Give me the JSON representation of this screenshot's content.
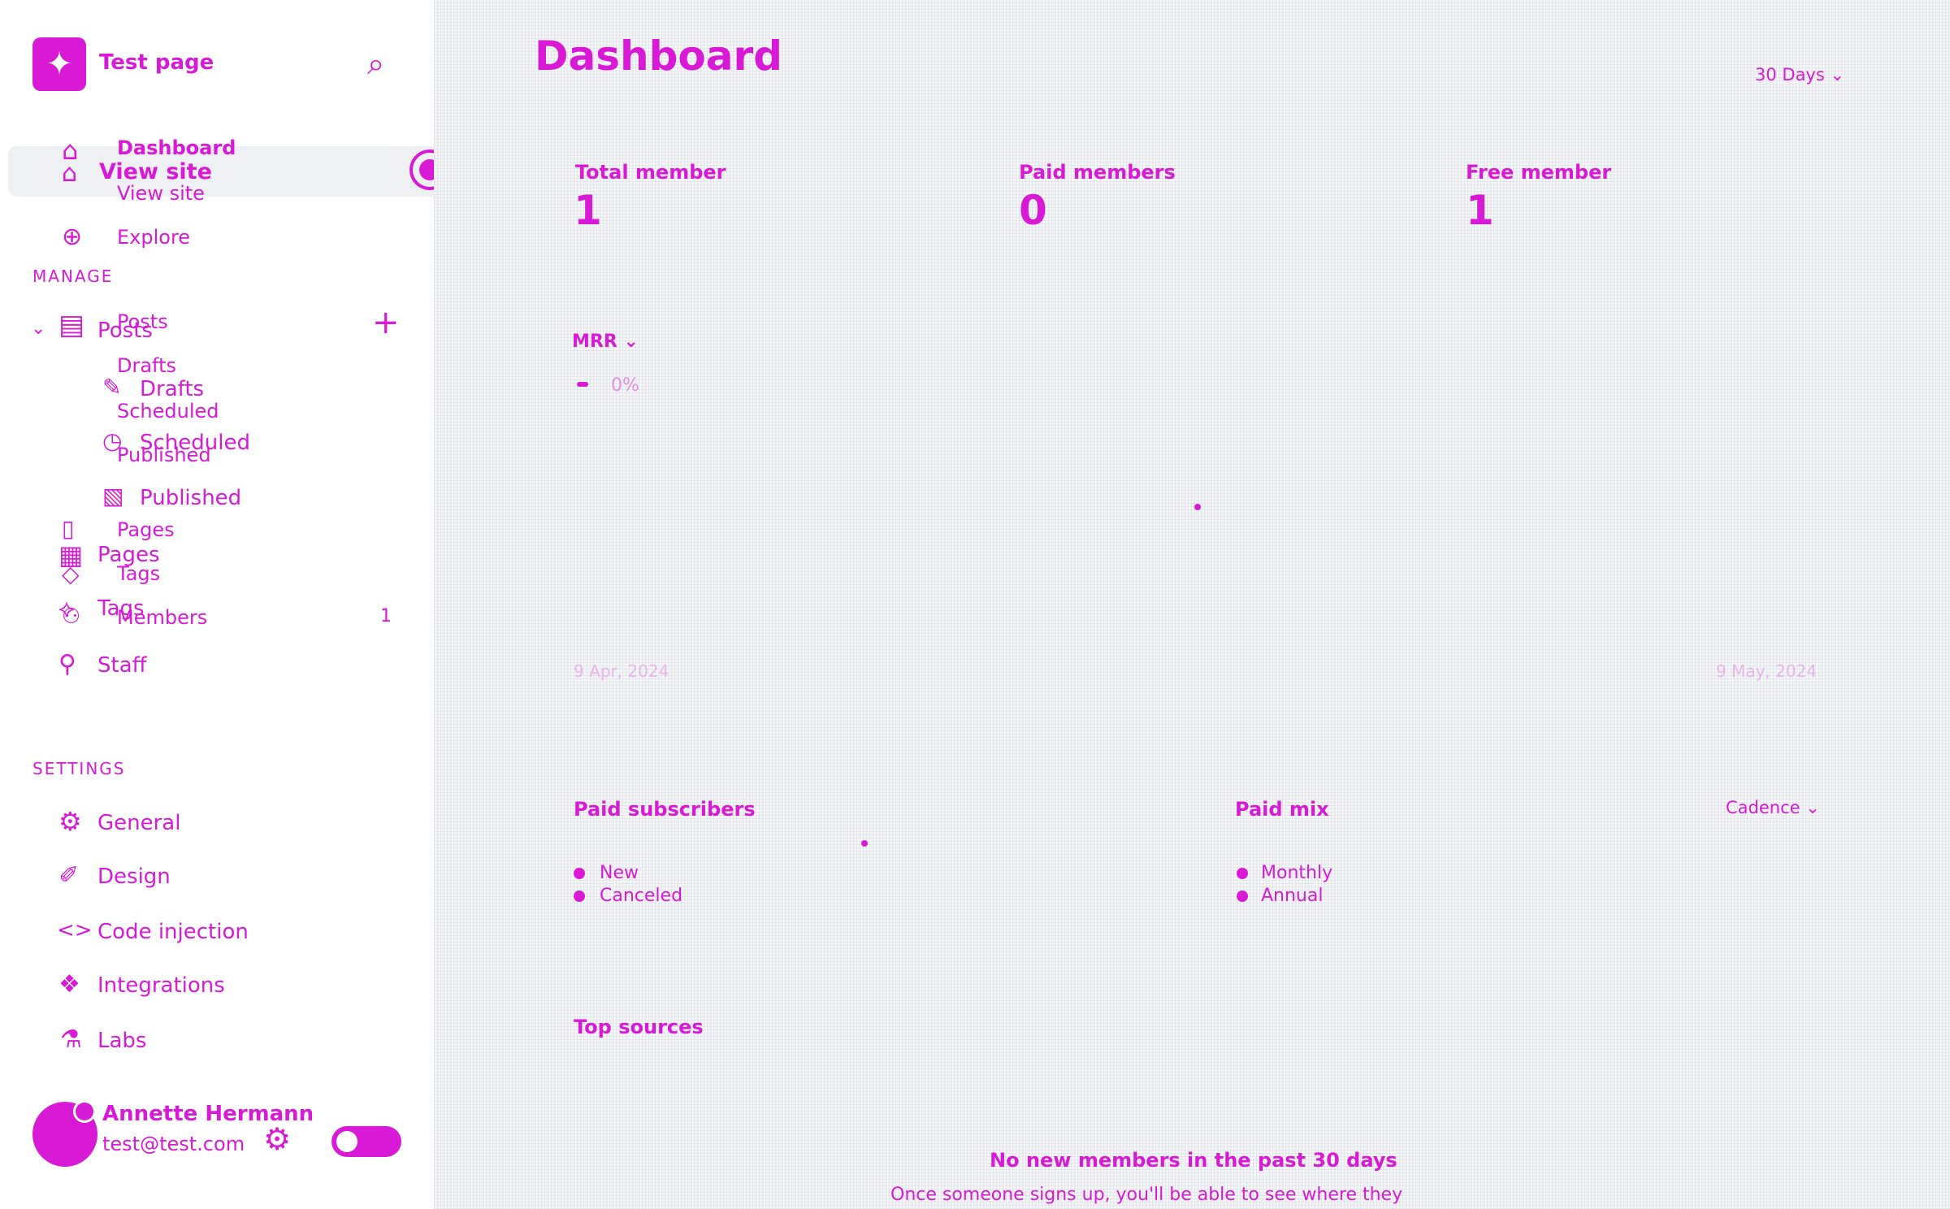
{
  "site": {
    "title": "Test page"
  },
  "sidebar": {
    "nav": {
      "dashboard": "Dashboard",
      "view_site": "View site",
      "explore": "Explore"
    },
    "manage_heading": "MANAGE",
    "manage": {
      "posts": "Posts",
      "drafts": "Drafts",
      "scheduled": "Scheduled",
      "published": "Published",
      "pages": "Pages",
      "tags": "Tags",
      "members": "Members",
      "members_count": "1",
      "staff": "Staff"
    },
    "settings_heading": "SETTINGS",
    "settings": {
      "general": "General",
      "design": "Design",
      "code_injection": "Code injection",
      "integrations": "Integrations",
      "labs": "Labs"
    },
    "user": {
      "name": "Annette Hermann",
      "email": "test@test.com"
    }
  },
  "main": {
    "title": "Dashboard",
    "range": "30 Days",
    "stats": [
      {
        "label": "Total member",
        "value": "1"
      },
      {
        "label": "Paid members",
        "value": "0"
      },
      {
        "label": "Free member",
        "value": "1"
      }
    ],
    "mrr": {
      "label": "MRR",
      "change": "0%"
    },
    "chart_dates": {
      "start": "9 Apr, 2024",
      "end": "9 May, 2024"
    },
    "paid_subscribers": {
      "title": "Paid subscribers",
      "legend": [
        "New",
        "Canceled"
      ]
    },
    "paid_mix": {
      "title": "Paid mix",
      "selector": "Cadence",
      "legend": [
        "Monthly",
        "Annual"
      ]
    },
    "top_sources": {
      "title": "Top sources",
      "empty_title": "No new members in the past 30 days",
      "empty_text": "Once someone signs up, you'll be able to see where they"
    }
  },
  "colors": {
    "accent": "#d81ad6",
    "sidebar_bg": "#ffffff",
    "main_bg": "#f5f6f8"
  },
  "icons": [
    "logo-icon",
    "search-icon",
    "home-icon",
    "view-site-icon",
    "explore-icon",
    "chevron-down-icon",
    "posts-icon",
    "plus-icon",
    "pencil-icon",
    "clock-icon",
    "published-icon",
    "pages-icon",
    "tags-icon",
    "members-icon",
    "staff-icon",
    "gear-icon",
    "brush-icon",
    "code-icon",
    "integrations-icon",
    "labs-icon",
    "user-settings-icon"
  ]
}
